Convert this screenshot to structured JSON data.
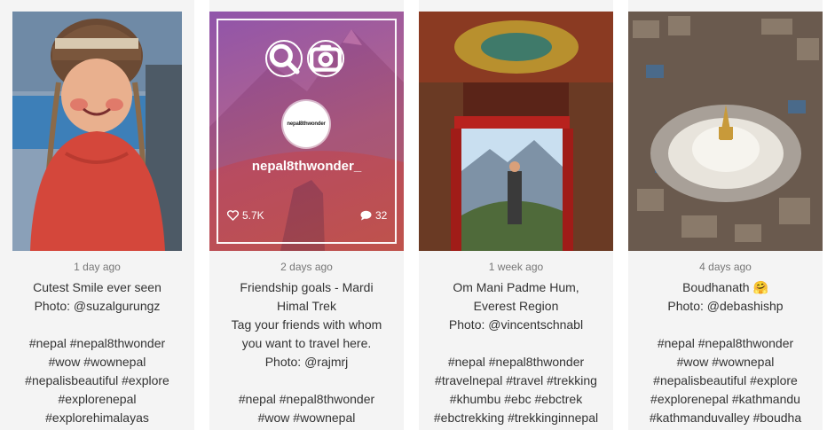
{
  "posts": [
    {
      "time": "1 day ago",
      "caption": "Cutest Smile ever seen\nPhoto: @suzalgurungz\n\n#nepal #nepal8thwonder\n#wow #wownepal\n#nepalisbeautiful #explore\n#explorenepal\n#explorehimalayas"
    },
    {
      "time": "2 days ago",
      "caption": "Friendship goals - Mardi\nHimal Trek\nTag your friends with whom\nyou want to travel here.\nPhoto: @rajmrj\n\n#nepal #nepal8thwonder\n#wow #wownepal"
    },
    {
      "time": "1 week ago",
      "caption": "Om Mani Padme Hum,\nEverest Region\nPhoto: @vincentschnabl\n\n#nepal #nepal8thwonder\n#travelnepal #travel #trekking\n#khumbu #ebc #ebctrek\n#ebctrekking #trekkinginnepal"
    },
    {
      "time": "4 days ago",
      "caption": "Boudhanath 🤗\nPhoto: @debashishp\n\n#nepal #nepal8thwonder\n#wow #wownepal\n#nepalisbeautiful #explore\n#explorenepal #kathmandu\n#kathmanduvalley #boudha"
    }
  ],
  "overlay": {
    "username": "nepal8thwonder_",
    "avatar_text": "nepal8thwonder",
    "likes": "5.7K",
    "comments": "32",
    "icons": [
      "search-icon",
      "camera-icon",
      "heart-icon",
      "comment-icon"
    ]
  },
  "colors": {
    "overlay_top": "#8c3ca0",
    "overlay_bottom": "#c85050",
    "card_bg": "#f4f4f4"
  }
}
